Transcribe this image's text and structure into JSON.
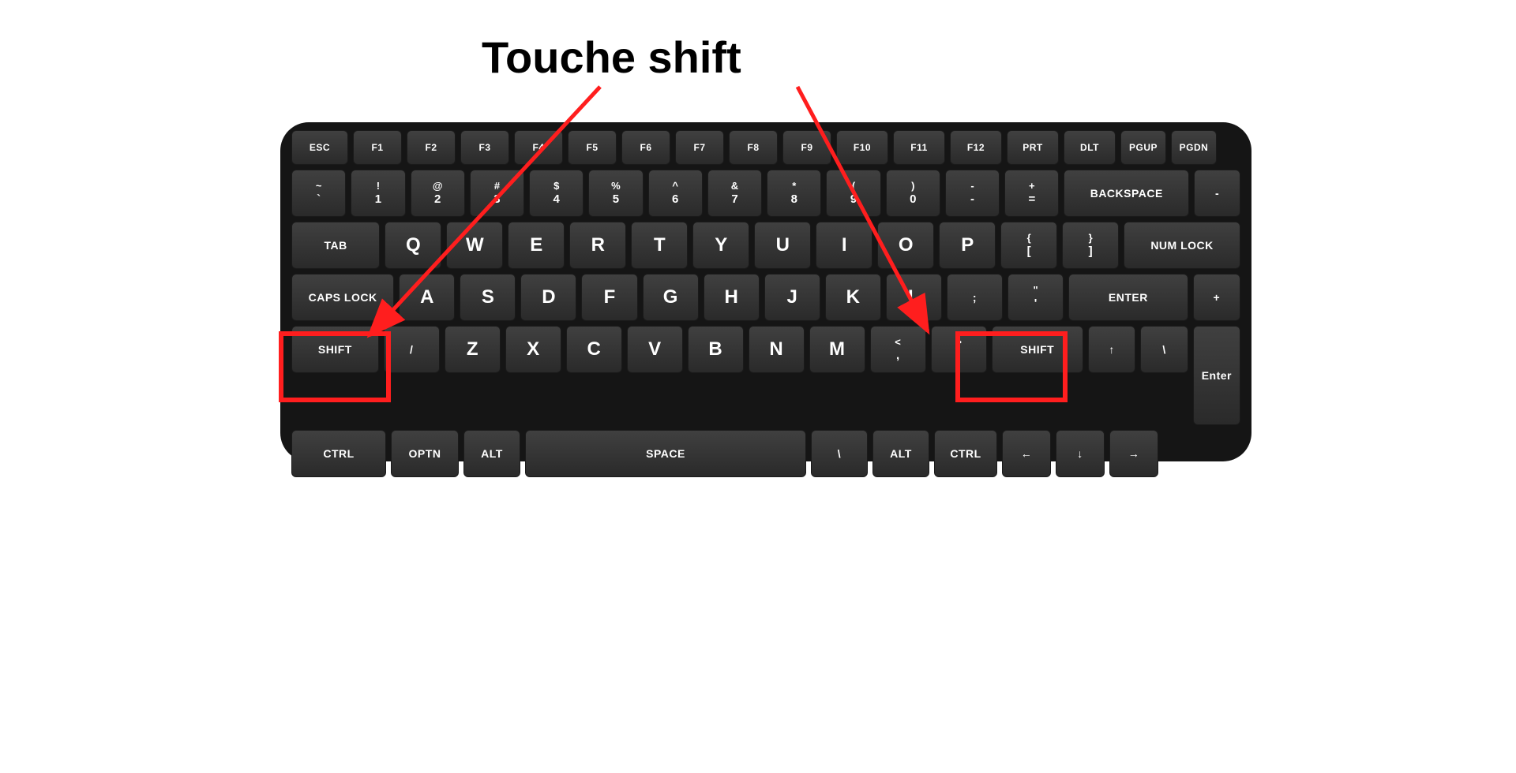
{
  "title": "Touche shift",
  "annotation_color": "#ff1e1e",
  "rows": {
    "r0": [
      "ESC",
      "F1",
      "F2",
      "F3",
      "F4",
      "F5",
      "F6",
      "F7",
      "F8",
      "F9",
      "F10",
      "F11",
      "F12",
      "PRT",
      "DLT",
      "PGUP",
      "PGDN"
    ],
    "r1": [
      [
        "~",
        "`"
      ],
      [
        "!",
        "1"
      ],
      [
        "@",
        "2"
      ],
      [
        "#",
        "3"
      ],
      [
        "$",
        "4"
      ],
      [
        "%",
        "5"
      ],
      [
        "^",
        "6"
      ],
      [
        "&",
        "7"
      ],
      [
        "*",
        "8"
      ],
      [
        "(",
        "9"
      ],
      [
        ")",
        "0"
      ],
      [
        "-",
        "-"
      ],
      [
        "+",
        "="
      ],
      "BACKSPACE",
      "-"
    ],
    "r2": [
      "TAB",
      "Q",
      "W",
      "E",
      "R",
      "T",
      "Y",
      "U",
      "I",
      "O",
      "P",
      [
        "{",
        "["
      ],
      [
        "}",
        "]"
      ],
      "NUM LOCK"
    ],
    "r3": [
      "CAPS LOCK",
      "A",
      "S",
      "D",
      "F",
      "G",
      "H",
      "J",
      "K",
      "L",
      ";",
      [
        "\"",
        "'"
      ],
      "ENTER"
    ],
    "r4": [
      "SHIFT",
      "/",
      "Z",
      "X",
      "C",
      "V",
      "B",
      "N",
      "M",
      [
        "<",
        ","
      ],
      [
        ">",
        "."
      ],
      "SHIFT",
      "↑",
      "\\"
    ],
    "r5": [
      "CTRL",
      "OPTN",
      "ALT",
      "SPACE",
      "\\",
      "ALT",
      "CTRL",
      "←",
      "↓",
      "→"
    ]
  },
  "side": {
    "plus": "+",
    "enter": "Enter"
  }
}
